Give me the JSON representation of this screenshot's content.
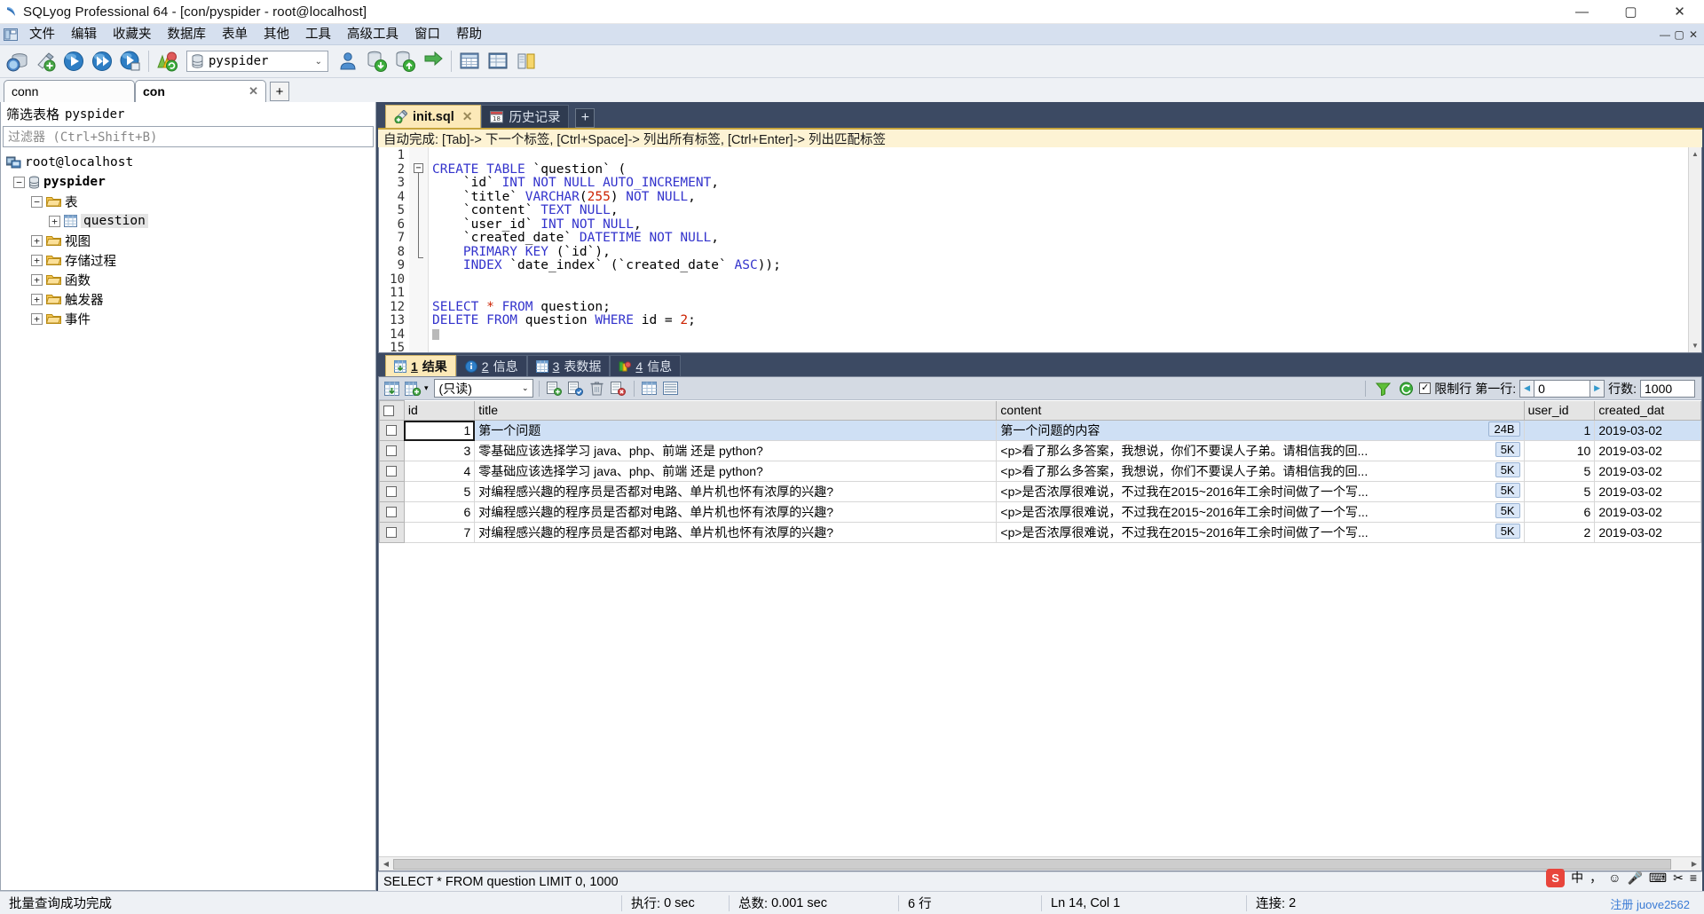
{
  "window": {
    "title": "SQLyog Professional 64 - [con/pyspider - root@localhost]",
    "app_icon": "sqlyog-icon",
    "minimize": "—",
    "maximize": "▢",
    "close": "✕",
    "mdi_minimize": "—",
    "mdi_restore": "▢",
    "mdi_close": "✕"
  },
  "menu": {
    "items": [
      {
        "label": "文件",
        "name": "menu-file"
      },
      {
        "label": "编辑",
        "name": "menu-edit"
      },
      {
        "label": "收藏夹",
        "name": "menu-favorites"
      },
      {
        "label": "数据库",
        "name": "menu-database"
      },
      {
        "label": "表单",
        "name": "menu-table"
      },
      {
        "label": "其他",
        "name": "menu-others"
      },
      {
        "label": "工具",
        "name": "menu-tools"
      },
      {
        "label": "高级工具",
        "name": "menu-advanced-tools"
      },
      {
        "label": "窗口",
        "name": "menu-window"
      },
      {
        "label": "帮助",
        "name": "menu-help"
      }
    ]
  },
  "toolbar": {
    "database_selector": "pyspider",
    "caret": "⌄"
  },
  "connection_tabs": {
    "tabs": [
      {
        "label": "conn",
        "selected": false
      },
      {
        "label": "con",
        "selected": true,
        "close": "✕"
      }
    ],
    "add": "+"
  },
  "left_panel": {
    "title_prefix": "筛选表格",
    "title_db": "pyspider",
    "filter_placeholder": "过滤器 (Ctrl+Shift+B)",
    "tree": [
      {
        "label": "root@localhost",
        "indent": 0,
        "expander": "",
        "icon": "host-icon",
        "mono": true,
        "bold": false
      },
      {
        "label": "pyspider",
        "indent": 1,
        "expander": "−",
        "icon": "database-icon",
        "mono": true,
        "bold": true
      },
      {
        "label": "表",
        "indent": 2,
        "expander": "−",
        "icon": "folder-icon",
        "mono": false,
        "bold": false
      },
      {
        "label": "question",
        "indent": 3,
        "expander": "+",
        "icon": "table-icon",
        "mono": true,
        "bold": false,
        "selected": true
      },
      {
        "label": "视图",
        "indent": 2,
        "expander": "+",
        "icon": "folder-icon",
        "mono": false,
        "bold": false
      },
      {
        "label": "存储过程",
        "indent": 2,
        "expander": "+",
        "icon": "folder-icon",
        "mono": false,
        "bold": false
      },
      {
        "label": "函数",
        "indent": 2,
        "expander": "+",
        "icon": "folder-icon",
        "mono": false,
        "bold": false
      },
      {
        "label": "触发器",
        "indent": 2,
        "expander": "+",
        "icon": "folder-icon",
        "mono": false,
        "bold": false
      },
      {
        "label": "事件",
        "indent": 2,
        "expander": "+",
        "icon": "folder-icon",
        "mono": false,
        "bold": false
      }
    ]
  },
  "editor": {
    "tabs": [
      {
        "label": "init.sql",
        "selected": true,
        "icon": "sql-file-icon",
        "close": "✕"
      },
      {
        "label": "历史记录",
        "selected": false,
        "icon": "calendar-icon"
      }
    ],
    "add": "+",
    "hint": "自动完成: [Tab]-> 下一个标签, [Ctrl+Space]-> 列出所有标签, [Ctrl+Enter]-> 列出匹配标签",
    "lines": [
      {
        "n": 1,
        "text": ""
      },
      {
        "n": 2,
        "text": "CREATE TABLE `question` ("
      },
      {
        "n": 3,
        "text": "    `id` INT NOT NULL AUTO_INCREMENT,"
      },
      {
        "n": 4,
        "text": "    `title` VARCHAR(255) NOT NULL,"
      },
      {
        "n": 5,
        "text": "    `content` TEXT NULL,"
      },
      {
        "n": 6,
        "text": "    `user_id` INT NOT NULL,"
      },
      {
        "n": 7,
        "text": "    `created_date` DATETIME NOT NULL,"
      },
      {
        "n": 8,
        "text": "    PRIMARY KEY (`id`),"
      },
      {
        "n": 9,
        "text": "    INDEX `date_index` (`created_date` ASC));"
      },
      {
        "n": 10,
        "text": ""
      },
      {
        "n": 11,
        "text": ""
      },
      {
        "n": 12,
        "text": "SELECT * FROM question;"
      },
      {
        "n": 13,
        "text": "DELETE FROM question WHERE id = 2;"
      },
      {
        "n": 14,
        "text": ""
      },
      {
        "n": 15,
        "text": ""
      }
    ],
    "fold_marker": "−"
  },
  "result_tabs": [
    {
      "num": "1",
      "label": "结果",
      "selected": true,
      "icon": "result-grid-icon"
    },
    {
      "num": "2",
      "label": "信息",
      "selected": false,
      "icon": "info-icon"
    },
    {
      "num": "3",
      "label": "表数据",
      "selected": false,
      "icon": "table-data-icon"
    },
    {
      "num": "4",
      "label": "信息",
      "selected": false,
      "icon": "objects-icon"
    }
  ],
  "grid_toolbar": {
    "mode": "(只读)",
    "caret": "⌄",
    "limit_checkbox_label": "限制行",
    "first_row_label": "第一行:",
    "first_row_value": "0",
    "rows_label": "行数:",
    "rows_value": "1000",
    "prev": "◀",
    "next": "▶",
    "checked": "✓"
  },
  "grid": {
    "columns": [
      "id",
      "title",
      "content",
      "user_id",
      "created_dat"
    ],
    "rows": [
      {
        "id": "1",
        "title": "第一个问题",
        "content": "第一个问题的内容",
        "size": "24B",
        "user_id": "1",
        "created_date": "2019-03-02",
        "selected": true
      },
      {
        "id": "3",
        "title": "零基础应该选择学习 java、php、前端 还是 python?",
        "content": "<p>看了那么多答案，我想说，你们不要误人子弟。请相信我的回...",
        "size": "5K",
        "user_id": "10",
        "created_date": "2019-03-02",
        "selected": false
      },
      {
        "id": "4",
        "title": "零基础应该选择学习 java、php、前端 还是 python?",
        "content": "<p>看了那么多答案，我想说，你们不要误人子弟。请相信我的回...",
        "size": "5K",
        "user_id": "5",
        "created_date": "2019-03-02",
        "selected": false
      },
      {
        "id": "5",
        "title": "对编程感兴趣的程序员是否都对电路、单片机也怀有浓厚的兴趣?",
        "content": "<p>是否浓厚很难说，不过我在2015~2016年工余时间做了一个写...",
        "size": "5K",
        "user_id": "5",
        "created_date": "2019-03-02",
        "selected": false
      },
      {
        "id": "6",
        "title": "对编程感兴趣的程序员是否都对电路、单片机也怀有浓厚的兴趣?",
        "content": "<p>是否浓厚很难说，不过我在2015~2016年工余时间做了一个写...",
        "size": "5K",
        "user_id": "6",
        "created_date": "2019-03-02",
        "selected": false
      },
      {
        "id": "7",
        "title": "对编程感兴趣的程序员是否都对电路、单片机也怀有浓厚的兴趣?",
        "content": "<p>是否浓厚很难说，不过我在2015~2016年工余时间做了一个写...",
        "size": "5K",
        "user_id": "2",
        "created_date": "2019-03-02",
        "selected": false
      }
    ]
  },
  "sql_status": "SELECT * FROM question LIMIT 0, 1000",
  "status_bar": {
    "message": "批量查询成功完成",
    "exec_label": "执行:",
    "exec_value": "0 sec",
    "total_label": "总数:",
    "total_value": "0.001 sec",
    "rows": "6 行",
    "cursor": "Ln 14, Col 1",
    "connection_label": "连接:",
    "connection_value": "2",
    "register_link": "注册",
    "register_user": "juove2562"
  },
  "ime": {
    "logo": "S",
    "lang": "中",
    "items": [
      "，",
      "☺",
      "🎤",
      "⌨",
      "✂",
      "≡"
    ]
  },
  "colors": {
    "accent_tab": "#fce9b8",
    "panel_dark": "#3c4a63",
    "keyword": "#3333cc",
    "number": "#cc2200",
    "selection": "#cfe0f5"
  }
}
